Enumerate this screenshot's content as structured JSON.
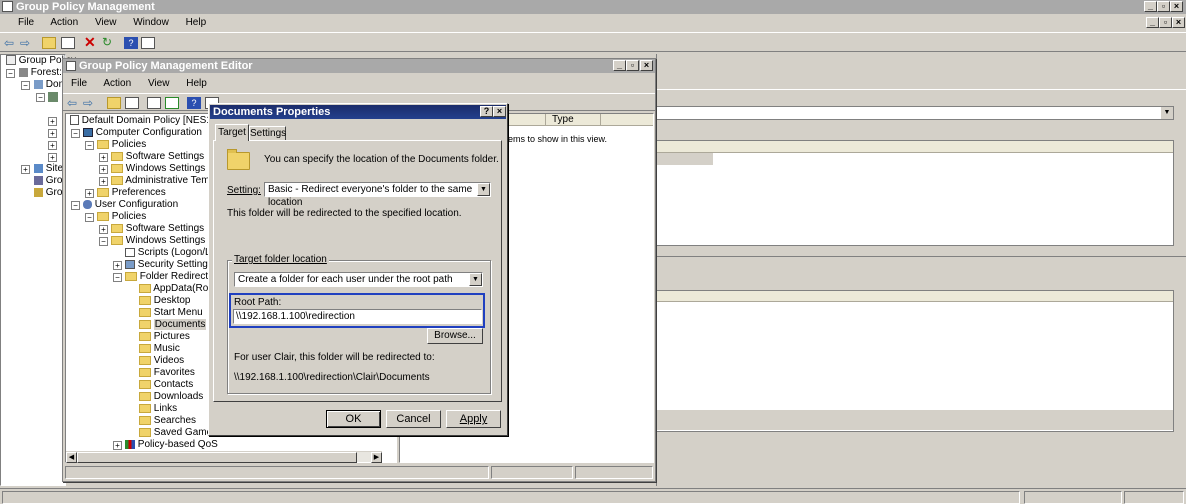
{
  "gpm": {
    "title": "Group Policy Management",
    "menu": [
      "File",
      "Action",
      "View",
      "Window",
      "Help"
    ],
    "tree": [
      "Group Policy",
      "Forest:",
      "Dom",
      "Sites",
      "Grou",
      "Grou"
    ]
  },
  "gpme": {
    "title": "Group Policy Management Editor",
    "menu": [
      "File",
      "Action",
      "View",
      "Help"
    ],
    "list_header": "Type",
    "list_empty": "ems to show in this view.",
    "tree": {
      "root": "Default Domain Policy [NES1.NT.CC",
      "computer_config": "Computer Configuration",
      "policies": "Policies",
      "software_settings": "Software Settings",
      "windows_settings": "Windows Settings",
      "admin_templates": "Administrative Template",
      "preferences": "Preferences",
      "user_config": "User Configuration",
      "u_policies": "Policies",
      "u_software_settings": "Software Settings",
      "u_windows_settings": "Windows Settings",
      "scripts": "Scripts (Logon/Logo",
      "security_settings": "Security Settings",
      "folder_redirection": "Folder Redirection",
      "folders": [
        "AppData(Roam",
        "Desktop",
        "Start Menu",
        "Documents",
        "Pictures",
        "Music",
        "Videos",
        "Favorites",
        "Contacts",
        "Downloads",
        "Links",
        "Searches",
        "Saved Games"
      ],
      "policy_qos": "Policy-based QoS"
    }
  },
  "dialog": {
    "title": "Documents Properties",
    "help_btn": "?",
    "close_btn": "×",
    "tabs": [
      "Target",
      "Settings"
    ],
    "intro": "You can specify the location of the Documents folder.",
    "setting_label": "Setting:",
    "setting_value": "Basic - Redirect everyone's folder to the same location",
    "redirect_note": "This folder will be redirected to the specified location.",
    "group_label": "Target folder location",
    "target_value": "Create a folder for each user under the root path",
    "root_label": "Root Path:",
    "root_value": "\\\\192.168.1.100\\redirection",
    "browse": "Browse...",
    "user_note": "For user Clair, this folder will be redirected to:",
    "resolved_path": "\\\\192.168.1.100\\redirection\\Clair\\Documents",
    "ok": "OK",
    "cancel": "Cancel",
    "apply": "Apply"
  }
}
